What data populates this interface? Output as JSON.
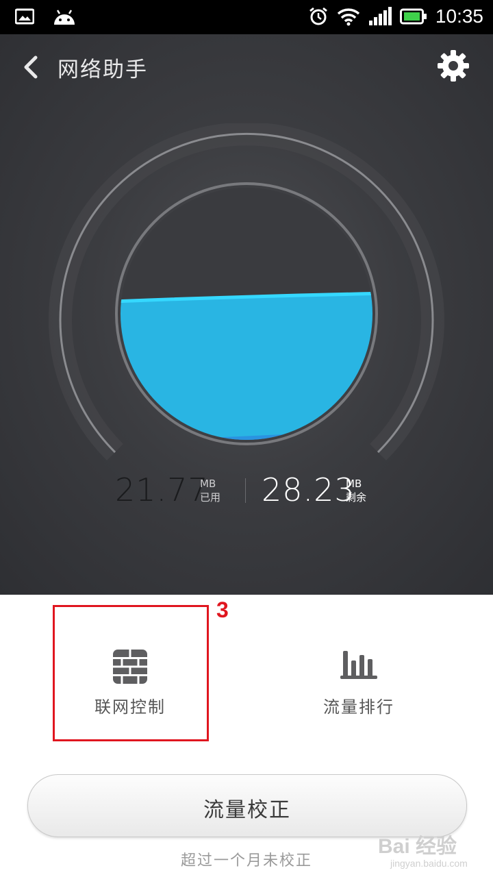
{
  "status_bar": {
    "time": "10:35"
  },
  "header": {
    "title": "网络助手"
  },
  "usage": {
    "used_value": "21.77",
    "used_unit": "MB",
    "used_label": "已用",
    "remaining_value": "28.23",
    "remaining_unit": "MB",
    "remaining_label": "剩余",
    "used_fraction": 0.4354
  },
  "options": [
    {
      "label": "联网控制",
      "icon": "firewall-icon"
    },
    {
      "label": "流量排行",
      "icon": "bar-chart-icon"
    }
  ],
  "annotation": {
    "number": "3"
  },
  "calibrate": {
    "label": "流量校正",
    "note": "超过一个月未校正"
  },
  "watermark": {
    "text": "Bai 经验",
    "sub": "jingyan.baidu.com"
  },
  "colors": {
    "water": "#29b5e3",
    "water_edge": "#35d8ff",
    "highlight": "#e0161f"
  }
}
